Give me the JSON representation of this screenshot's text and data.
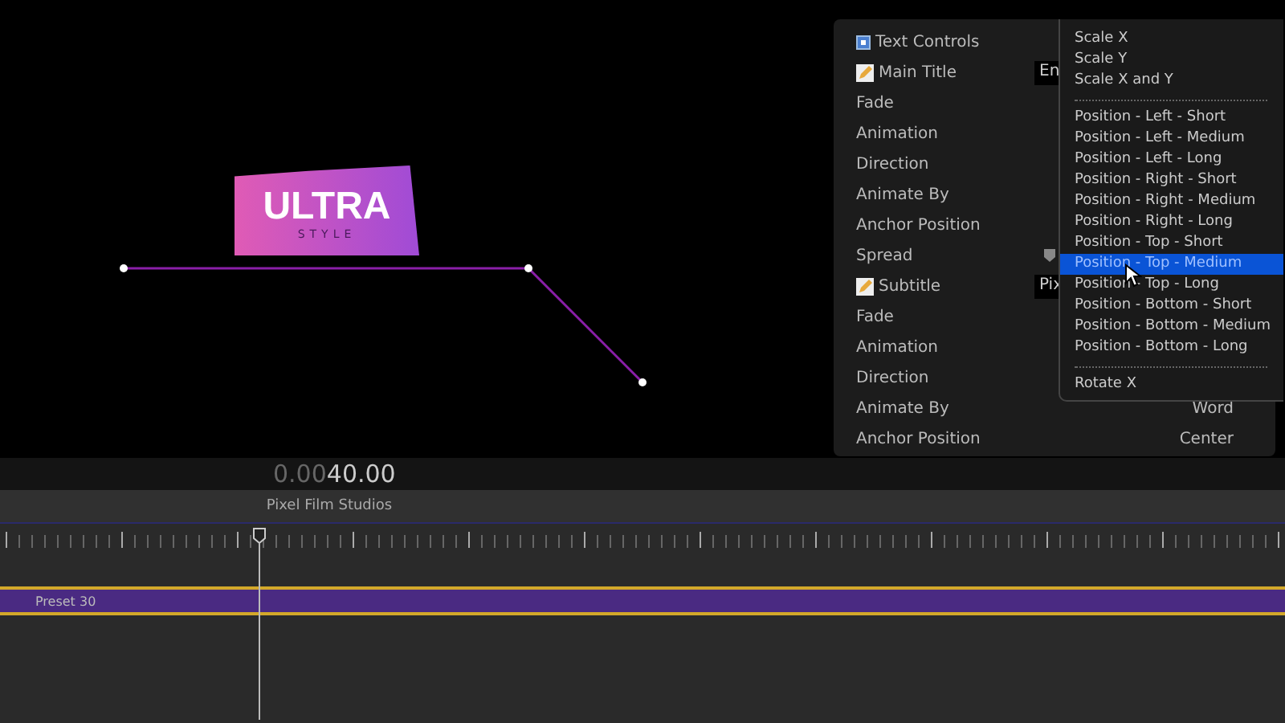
{
  "canvas": {
    "logo": {
      "title": "ULTRA",
      "subtitle": "STYLE"
    }
  },
  "inspector": {
    "rows": [
      {
        "kind": "checkbox",
        "label": "Text Controls",
        "checked": true
      },
      {
        "kind": "edit",
        "label": "Main Title",
        "value": "En"
      },
      {
        "kind": "plain",
        "label": "Fade"
      },
      {
        "kind": "plain",
        "label": "Animation"
      },
      {
        "kind": "plain",
        "label": "Direction"
      },
      {
        "kind": "plain",
        "label": "Animate By"
      },
      {
        "kind": "plain",
        "label": "Anchor Position"
      },
      {
        "kind": "slider",
        "label": "Spread"
      },
      {
        "kind": "edit",
        "label": "Subtitle",
        "value": "Pix"
      },
      {
        "kind": "plain",
        "label": "Fade"
      },
      {
        "kind": "plain",
        "label": "Animation"
      },
      {
        "kind": "plain",
        "label": "Direction"
      },
      {
        "kind": "plain",
        "label": "Animate By",
        "value": "Word"
      },
      {
        "kind": "plain",
        "label": "Anchor Position",
        "value": "Center"
      }
    ]
  },
  "menu": {
    "items": [
      {
        "kind": "item",
        "label": "Scale X",
        "selected": false
      },
      {
        "kind": "item",
        "label": "Scale Y",
        "selected": false
      },
      {
        "kind": "item",
        "label": "Scale X and Y",
        "selected": false
      },
      {
        "kind": "separator"
      },
      {
        "kind": "item",
        "label": "Position - Left - Short",
        "selected": false
      },
      {
        "kind": "item",
        "label": "Position - Left - Medium",
        "selected": false
      },
      {
        "kind": "item",
        "label": "Position - Left - Long",
        "selected": false
      },
      {
        "kind": "item",
        "label": "Position - Right - Short",
        "selected": false
      },
      {
        "kind": "item",
        "label": "Position - Right - Medium",
        "selected": false
      },
      {
        "kind": "item",
        "label": "Position - Right - Long",
        "selected": false
      },
      {
        "kind": "item",
        "label": "Position - Top - Short",
        "selected": false
      },
      {
        "kind": "item",
        "label": "Position - Top - Medium",
        "selected": true
      },
      {
        "kind": "item",
        "label": "Position - Top - Long",
        "selected": false
      },
      {
        "kind": "item",
        "label": "Position - Bottom - Short",
        "selected": false
      },
      {
        "kind": "item",
        "label": "Position - Bottom - Medium",
        "selected": false
      },
      {
        "kind": "item",
        "label": "Position - Bottom - Long",
        "selected": false
      },
      {
        "kind": "separator"
      },
      {
        "kind": "item",
        "label": "Rotate X",
        "selected": false
      }
    ]
  },
  "timeline": {
    "timecode_dim": "0.00",
    "timecode": "40.00",
    "title": "Pixel Film Studios",
    "clip": {
      "label": "Preset 30"
    }
  }
}
